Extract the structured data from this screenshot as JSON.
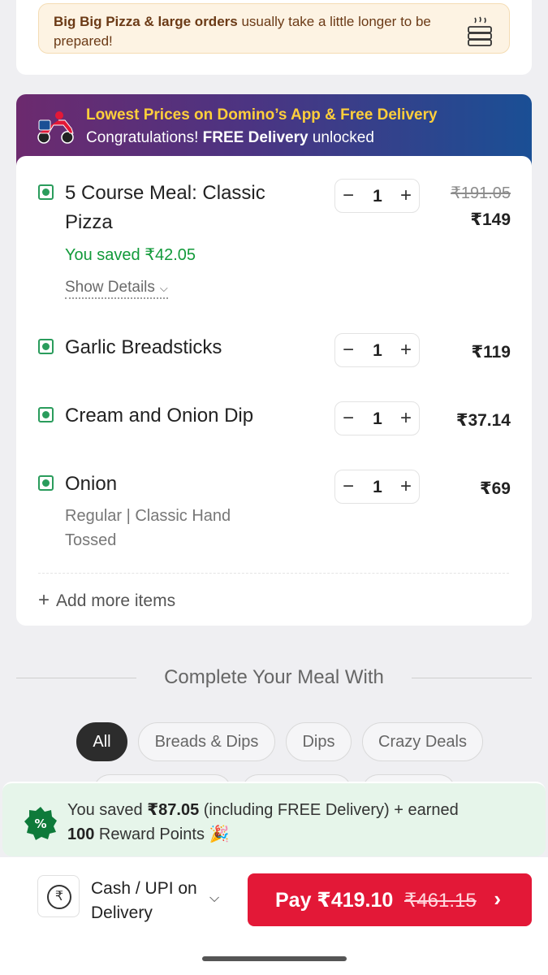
{
  "notice": {
    "bold": "Big Big Pizza & large orders",
    "rest": " usually take a little longer to be prepared!",
    "icon": "stacked-pizza-boxes-icon"
  },
  "banner": {
    "line1": "Lowest Prices on Domino’s App & Free Delivery",
    "line2_prefix": "Congratulations! ",
    "line2_bold": "FREE Delivery",
    "line2_suffix": " unlocked",
    "icon": "scooter-icon"
  },
  "cart": {
    "items": [
      {
        "name": "5 Course Meal: Classic Pizza",
        "qty": "1",
        "old_price": "₹191.05",
        "price": "₹149",
        "saved": "You saved ₹42.05",
        "details_label": "Show Details"
      },
      {
        "name": "Garlic Breadsticks",
        "qty": "1",
        "price": "₹119"
      },
      {
        "name": "Cream and Onion Dip",
        "qty": "1",
        "price": "₹37.14"
      },
      {
        "name": "Onion",
        "qty": "1",
        "price": "₹69",
        "desc": "Regular | Classic Hand Tossed"
      }
    ],
    "add_more": "Add more items",
    "minus": "−",
    "plus": "+"
  },
  "meal": {
    "title": "Complete Your Meal With",
    "chips": [
      "All",
      "Breads & Dips",
      "Dips",
      "Crazy Deals"
    ],
    "active_chip": "All"
  },
  "savings": {
    "prefix": "You saved ",
    "amount": "₹87.05",
    "middle": " (including FREE Delivery) + earned",
    "points": "100",
    "suffix": " Reward Points 🎉"
  },
  "footer": {
    "payment_method": "Cash / UPI on Delivery",
    "rupee_symbol": "₹",
    "pay_label": "Pay ₹419.10",
    "pay_strike": "₹461.15",
    "pay_arrow": "›"
  },
  "colors": {
    "accent": "#e31837",
    "veg": "#2a9c5c",
    "saved_green": "#129a3a",
    "banner_yellow": "#ffcf3b"
  }
}
